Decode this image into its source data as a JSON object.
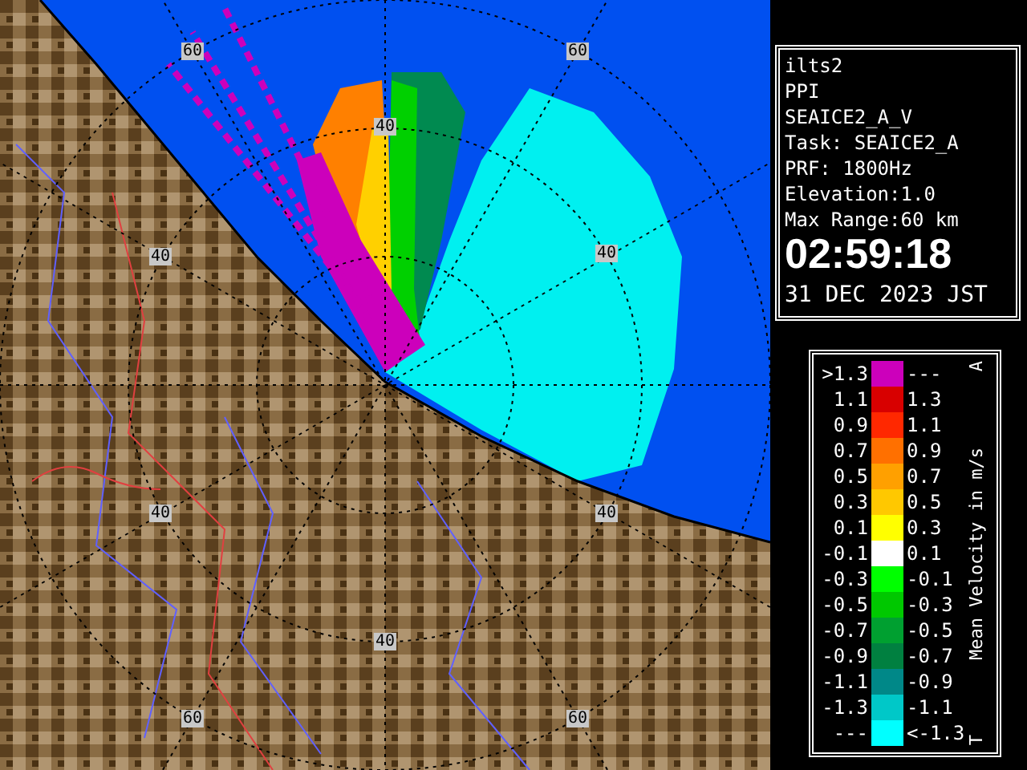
{
  "radar_map": {
    "range_labels": [
      "60",
      "60",
      "40",
      "40",
      "40",
      "40",
      "40",
      "40",
      "60",
      "60"
    ]
  },
  "info_panel": {
    "lines": [
      "ilts2",
      "PPI",
      "SEAICE2_A_V",
      "Task: SEAICE2_A",
      "PRF: 1800Hz",
      "Elevation:1.0",
      "Max Range:60 km"
    ],
    "time": "02:59:18",
    "date": "31 DEC 2023 JST"
  },
  "legend": {
    "title": "Mean Velocity in m/s",
    "top_mark": "A",
    "bottom_mark": "T",
    "rows": [
      {
        "lower": ">1.3",
        "upper": "---",
        "color": "#cc00bb"
      },
      {
        "lower": "1.1",
        "upper": "1.3",
        "color": "#d80000"
      },
      {
        "lower": "0.9",
        "upper": "1.1",
        "color": "#ff2800"
      },
      {
        "lower": "0.7",
        "upper": "0.9",
        "color": "#ff7000"
      },
      {
        "lower": "0.5",
        "upper": "0.7",
        "color": "#ffa000"
      },
      {
        "lower": "0.3",
        "upper": "0.5",
        "color": "#ffc800"
      },
      {
        "lower": "0.1",
        "upper": "0.3",
        "color": "#ffff00"
      },
      {
        "lower": "-0.1",
        "upper": "0.1",
        "color": "#ffffff"
      },
      {
        "lower": "-0.3",
        "upper": "-0.1",
        "color": "#00ff00"
      },
      {
        "lower": "-0.5",
        "upper": "-0.3",
        "color": "#00c800"
      },
      {
        "lower": "-0.7",
        "upper": "-0.5",
        "color": "#00a030"
      },
      {
        "lower": "-0.9",
        "upper": "-0.7",
        "color": "#008040"
      },
      {
        "lower": "-1.1",
        "upper": "-0.9",
        "color": "#008888"
      },
      {
        "lower": "-1.3",
        "upper": "-1.1",
        "color": "#00c8c8"
      },
      {
        "lower": "---",
        "upper": "<-1.3",
        "color": "#00ffff"
      }
    ]
  }
}
